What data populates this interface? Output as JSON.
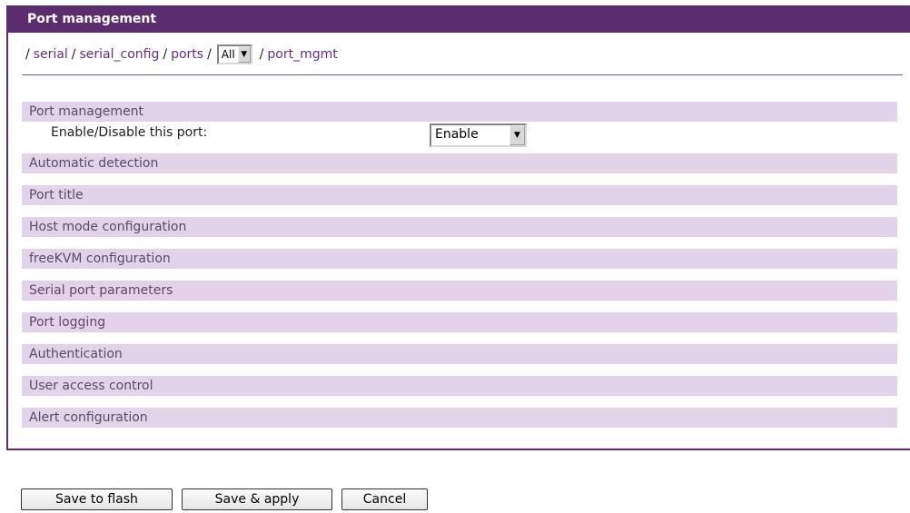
{
  "title": "Port management",
  "breadcrumb": {
    "serial": "serial",
    "serial_config": "serial_config",
    "ports": "ports",
    "select_value": "All",
    "port_mgmt": "port_mgmt",
    "separator": "/"
  },
  "sections": {
    "port_management": "Port management",
    "automatic_detection": "Automatic detection",
    "port_title": "Port title",
    "host_mode": "Host mode configuration",
    "freekvm": "freeKVM configuration",
    "serial_params": "Serial port parameters",
    "port_logging": "Port logging",
    "authentication": "Authentication",
    "user_access": "User access control",
    "alert_config": "Alert configuration"
  },
  "enable_row": {
    "label": "Enable/Disable this port:",
    "value": "Enable"
  },
  "buttons": {
    "save_flash": "Save to flash",
    "save_apply": "Save & apply",
    "cancel": "Cancel"
  },
  "colors": {
    "header": "#5c2d6e",
    "section_bar": "#e3d3ea",
    "link": "#6a2c86"
  },
  "icons": {
    "dropdown": "chevron-down-icon"
  }
}
